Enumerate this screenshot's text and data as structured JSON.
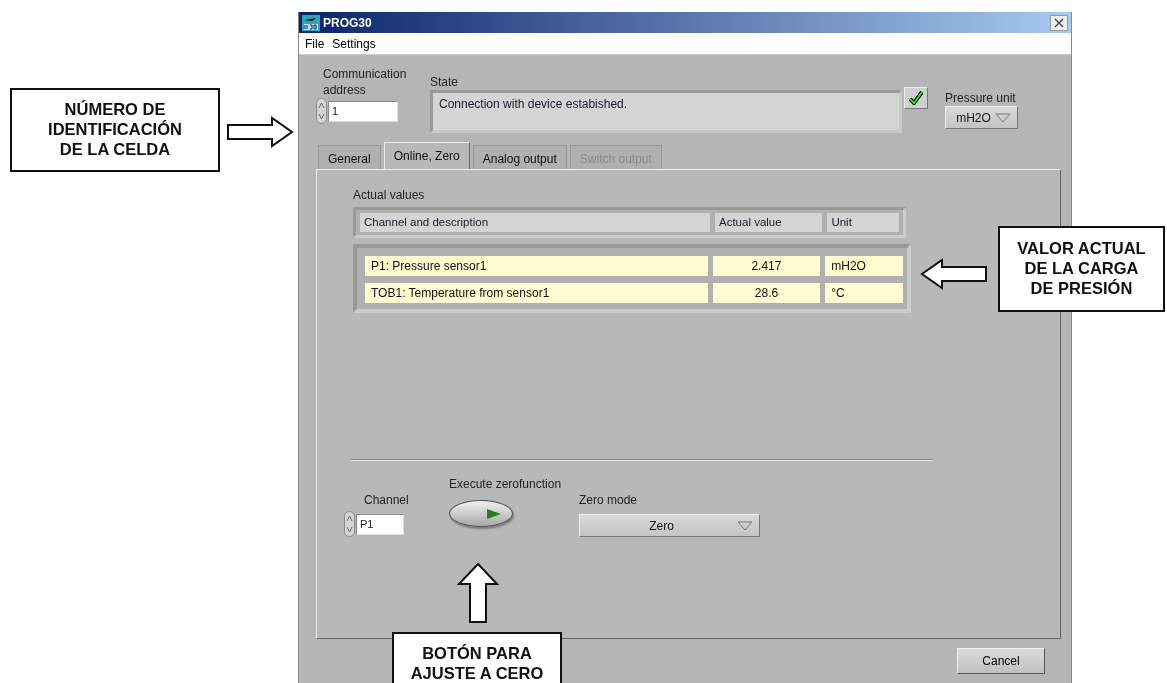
{
  "window": {
    "title": "PROG30"
  },
  "menu": [
    "File",
    "Settings"
  ],
  "communication_address": {
    "label": "Communication address",
    "value": "1"
  },
  "state": {
    "label": "State",
    "message": "Connection with device estabished.",
    "ok": true
  },
  "pressure_unit": {
    "label": "Pressure unit",
    "value": "mH2O"
  },
  "tabs": [
    {
      "label": "General",
      "selected": false,
      "disabled": false
    },
    {
      "label": "Online, Zero",
      "selected": true,
      "disabled": false
    },
    {
      "label": "Analog output",
      "selected": false,
      "disabled": false
    },
    {
      "label": "Switch output",
      "selected": false,
      "disabled": true
    }
  ],
  "actual_values": {
    "title": "Actual values",
    "columns": [
      "Channel and description",
      "Actual value",
      "Unit"
    ],
    "rows": [
      {
        "channel": "P1: Pressure sensor1",
        "value": "2.417",
        "unit": "mH2O"
      },
      {
        "channel": "TOB1: Temperature from sensor1",
        "value": "28.6",
        "unit": "°C"
      }
    ]
  },
  "zero": {
    "channel_label": "Channel",
    "channel": "P1",
    "execute_label": "Execute zerofunction",
    "mode_label": "Zero mode",
    "mode": "Zero"
  },
  "buttons": [
    "Cancel"
  ],
  "annotations": [
    {
      "text": "NÚMERO DE\nIDENTIFICACIÓN\nDE LA CELDA",
      "kind": "right"
    },
    {
      "text": "VALOR ACTUAL\nDE LA CARGA\nDE PRESIÓN",
      "kind": "left"
    },
    {
      "text": "BOTÓN PARA\nAJUSTE A CERO",
      "kind": "up"
    }
  ]
}
